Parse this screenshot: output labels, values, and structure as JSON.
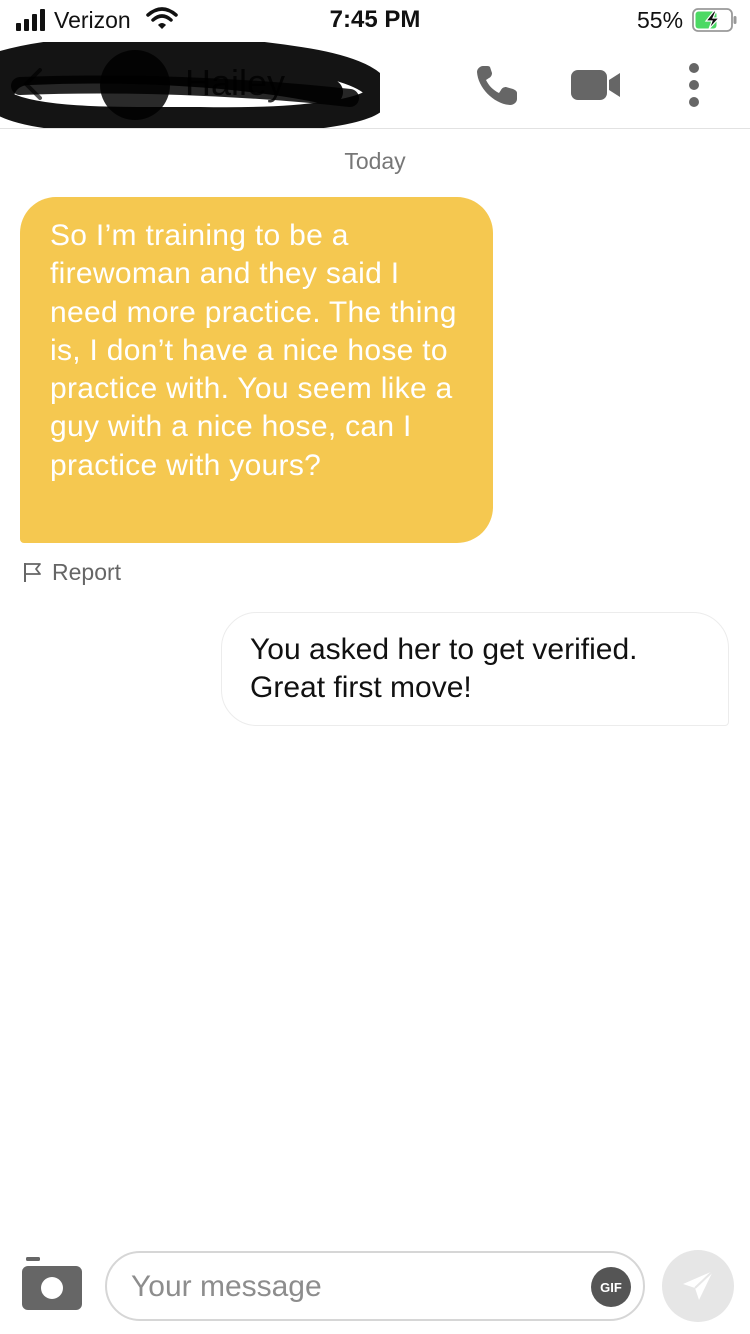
{
  "status_bar": {
    "carrier": "Verizon",
    "time": "7:45 PM",
    "battery_percent": "55%",
    "icons": [
      "signal-icon",
      "wifi-icon",
      "battery-charging-icon"
    ]
  },
  "header": {
    "contact_name": "Hailey",
    "icons": [
      "back-icon",
      "phone-icon",
      "video-camera-icon",
      "more-vertical-icon"
    ]
  },
  "chat": {
    "date_separator": "Today",
    "messages": [
      {
        "direction": "incoming",
        "text": "So I’m training to be a firewoman and they said I need more practice. The thing is, I don’t have a nice hose to practice with. You seem like a guy with a nice hose, can I practice with yours?",
        "bubble_color": "#f5c850"
      },
      {
        "direction": "outgoing",
        "text": "You asked her to get verified. Great first move!",
        "bubble_color": "#ffffff"
      }
    ],
    "report_label": "Report"
  },
  "composer": {
    "value": "",
    "placeholder": "Your message",
    "gif_label": "GIF",
    "icons": [
      "camera-icon",
      "send-icon"
    ]
  },
  "colors": {
    "accent": "#f5c850",
    "icon_gray": "#666666",
    "battery_green": "#4cd964"
  }
}
